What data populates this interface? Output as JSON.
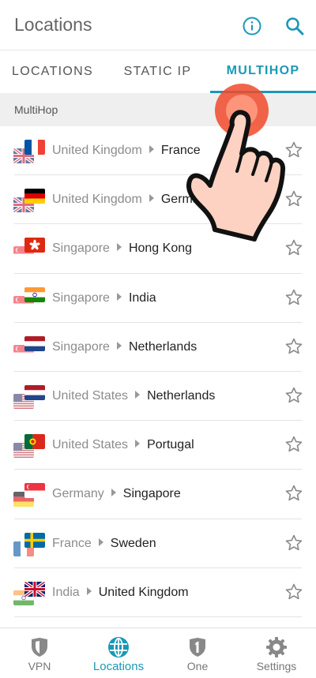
{
  "header": {
    "title": "Locations"
  },
  "tabs": [
    {
      "label": "LOCATIONS",
      "active": false
    },
    {
      "label": "STATIC IP",
      "active": false
    },
    {
      "label": "MULTIHOP",
      "active": true
    }
  ],
  "section": {
    "title": "MultiHop"
  },
  "routes": [
    {
      "from": "United Kingdom",
      "to": "France",
      "from_flag": "flag-uk",
      "to_flag": "flag-france"
    },
    {
      "from": "United Kingdom",
      "to": "Germany",
      "from_flag": "flag-uk",
      "to_flag": "flag-germany"
    },
    {
      "from": "Singapore",
      "to": "Hong Kong",
      "from_flag": "flag-singapore",
      "to_flag": "flag-hong-kong"
    },
    {
      "from": "Singapore",
      "to": "India",
      "from_flag": "flag-singapore",
      "to_flag": "flag-india"
    },
    {
      "from": "Singapore",
      "to": "Netherlands",
      "from_flag": "flag-singapore",
      "to_flag": "flag-netherlands"
    },
    {
      "from": "United States",
      "to": "Netherlands",
      "from_flag": "flag-us",
      "to_flag": "flag-netherlands"
    },
    {
      "from": "United States",
      "to": "Portugal",
      "from_flag": "flag-us",
      "to_flag": "flag-portugal"
    },
    {
      "from": "Germany",
      "to": "Singapore",
      "from_flag": "flag-germany",
      "to_flag": "flag-singapore"
    },
    {
      "from": "France",
      "to": "Sweden",
      "from_flag": "flag-france",
      "to_flag": "flag-sweden"
    },
    {
      "from": "India",
      "to": "United Kingdom",
      "from_flag": "flag-india",
      "to_flag": "flag-uk"
    }
  ],
  "bottom_nav": [
    {
      "label": "VPN",
      "icon": "shield-icon",
      "active": false
    },
    {
      "label": "Locations",
      "icon": "globe-icon",
      "active": true
    },
    {
      "label": "One",
      "icon": "one-badge-icon",
      "active": false
    },
    {
      "label": "Settings",
      "icon": "gear-icon",
      "active": false
    }
  ],
  "colors": {
    "accent": "#1a98b8",
    "tap_indicator": "#f04a2a"
  }
}
